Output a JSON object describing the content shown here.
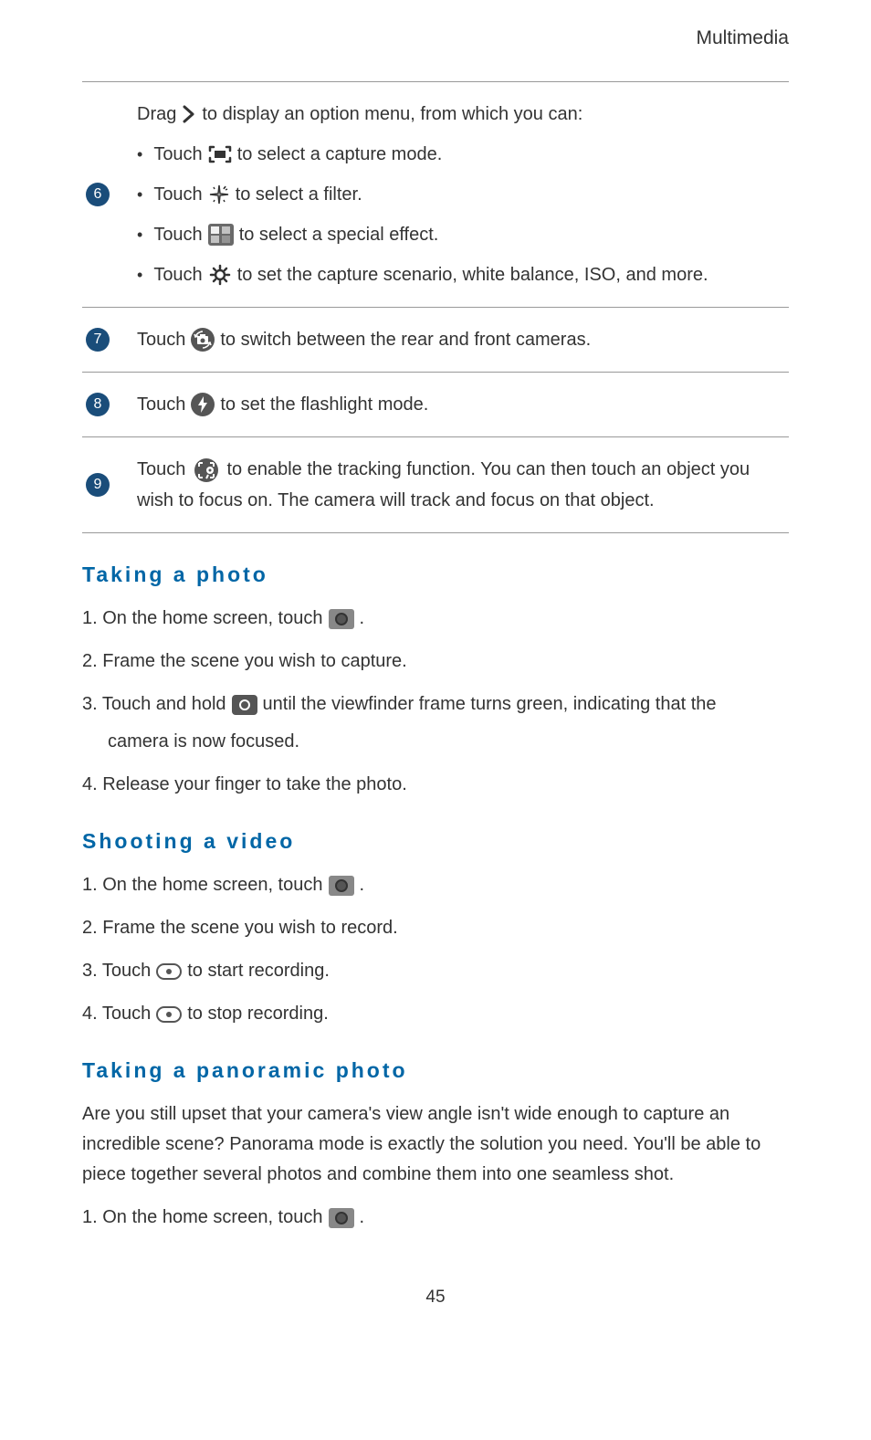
{
  "header": {
    "category": "Multimedia"
  },
  "table": {
    "row6": {
      "badge": "6",
      "drag_pre": "Drag",
      "drag_post": "to display an option menu, from which you can:",
      "capture_pre": "Touch",
      "capture_post": "to select a capture mode.",
      "filter_pre": "Touch",
      "filter_post": "to select a filter.",
      "effect_pre": "Touch",
      "effect_post": "to select a special effect.",
      "scenario_pre": "Touch",
      "scenario_post": "to set the capture scenario, white balance, ISO, and more."
    },
    "row7": {
      "badge": "7",
      "pre": "Touch",
      "post": "to switch between the rear and front cameras."
    },
    "row8": {
      "badge": "8",
      "pre": "Touch",
      "post": "to set the flashlight mode."
    },
    "row9": {
      "badge": "9",
      "pre": "Touch",
      "post": "to enable the tracking function. You can then touch an object you wish to focus on. The camera will track and focus on that object."
    }
  },
  "sections": {
    "photo": {
      "heading": "Taking  a  photo",
      "step1_pre": "1. On the home screen, touch",
      "step1_post": ".",
      "step2": "2. Frame the scene you wish to capture.",
      "step3_pre": "3. Touch and hold",
      "step3_post": "until the viewfinder frame turns green, indicating that the",
      "step3_cont": "camera is now focused.",
      "step4": "4. Release your finger to take the photo."
    },
    "video": {
      "heading": "Shooting  a  video",
      "step1_pre": "1. On the home screen, touch",
      "step1_post": ".",
      "step2": "2. Frame the scene you wish to record.",
      "step3_pre": "3. Touch",
      "step3_post": "to start recording.",
      "step4_pre": "4. Touch",
      "step4_post": "to stop recording."
    },
    "panoramic": {
      "heading": "Taking  a  panoramic  photo",
      "intro": "Are you still upset that your camera's view angle isn't wide enough to capture an incredible scene? Panorama mode is exactly the solution you need. You'll be able to piece together several photos and combine them into one seamless shot.",
      "step1_pre": "1. On the home screen, touch",
      "step1_post": "."
    }
  },
  "page_number": "45"
}
